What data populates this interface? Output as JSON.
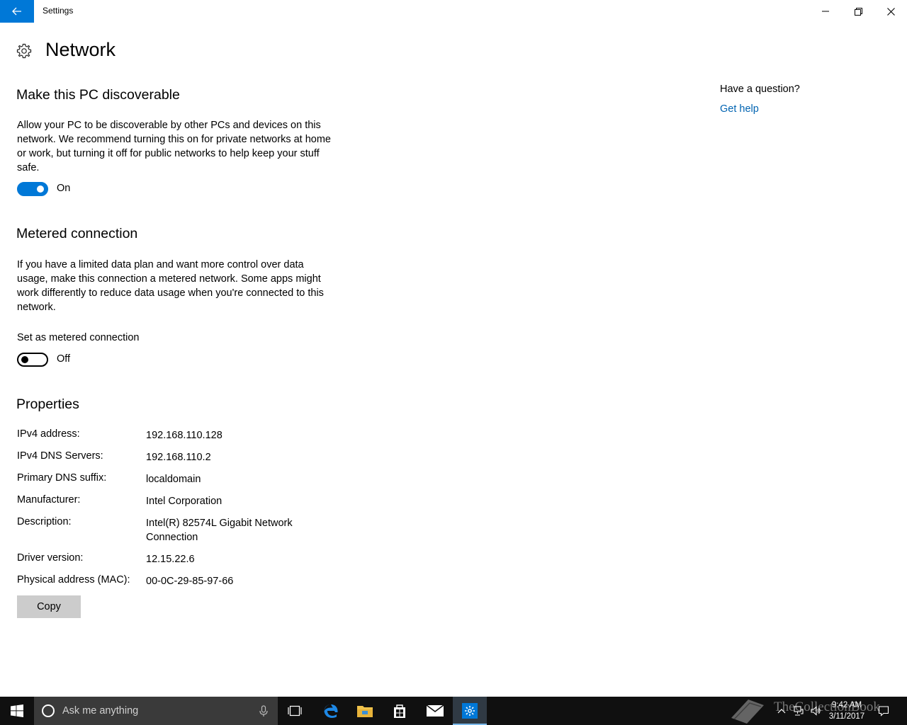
{
  "window": {
    "title": "Settings",
    "accent_color": "#0078d7"
  },
  "page": {
    "title": "Network"
  },
  "discoverable": {
    "heading": "Make this PC discoverable",
    "description": "Allow your PC to be discoverable by other PCs and devices on this network. We recommend turning this on for private networks at home or work, but turning it off for public networks to help keep your stuff safe.",
    "toggle_on": true,
    "toggle_state": "On"
  },
  "metered": {
    "heading": "Metered connection",
    "description": "If you have a limited data plan and want more control over data usage, make this connection a metered network. Some apps might work differently to reduce data usage when you're connected to this network.",
    "label": "Set as metered connection",
    "toggle_on": false,
    "toggle_state": "Off"
  },
  "properties": {
    "heading": "Properties",
    "rows": [
      {
        "label": "IPv4 address:",
        "value": "192.168.110.128"
      },
      {
        "label": "IPv4 DNS Servers:",
        "value": "192.168.110.2"
      },
      {
        "label": "Primary DNS suffix:",
        "value": "localdomain"
      },
      {
        "label": "Manufacturer:",
        "value": "Intel Corporation"
      },
      {
        "label": "Description:",
        "value": "Intel(R) 82574L Gigabit Network Connection"
      },
      {
        "label": "Driver version:",
        "value": "12.15.22.6"
      },
      {
        "label": "Physical address (MAC):",
        "value": "00-0C-29-85-97-66"
      }
    ],
    "copy_label": "Copy"
  },
  "help": {
    "question": "Have a question?",
    "link": "Get help"
  },
  "taskbar": {
    "search_placeholder": "Ask me anything",
    "apps": [
      "task-view-icon",
      "edge-icon",
      "file-explorer-icon",
      "store-icon",
      "mail-icon",
      "settings-icon"
    ],
    "clock_time": "9:42 AM",
    "clock_date": "3/11/2017",
    "watermark": "TheCollectionBook"
  }
}
